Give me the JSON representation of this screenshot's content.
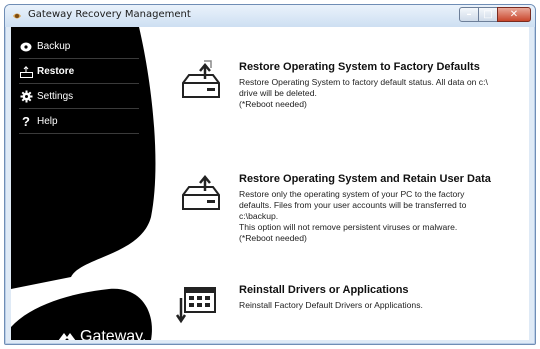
{
  "window": {
    "title": "Gateway Recovery Management"
  },
  "sidebar": {
    "items": [
      {
        "label": "Backup",
        "icon": "backup-disc-icon"
      },
      {
        "label": "Restore",
        "icon": "restore-icon",
        "active": true
      },
      {
        "label": "Settings",
        "icon": "gear-icon"
      },
      {
        "label": "Help",
        "icon": "question-mark-icon"
      }
    ],
    "brand": "Gateway."
  },
  "options": [
    {
      "title": "Restore Operating System to Factory Defaults",
      "description": "Restore Operating System to factory default status. All data on c:\\\ndrive will be deleted.\n(*Reboot needed)"
    },
    {
      "title": "Restore Operating System and Retain User Data",
      "description": "Restore only the operating system of your PC to the factory\ndefaults. Files from your user accounts will be transferred to\nc:\\backup.\nThis option will not remove persistent viruses or malware.\n(*Reboot needed)"
    },
    {
      "title": "Reinstall Drivers or Applications",
      "description": "Reinstall Factory Default Drivers or Applications."
    }
  ],
  "colors": {
    "sidebar": "#000000",
    "close_button": "#c9462c",
    "frame": "#dfeaf6"
  }
}
